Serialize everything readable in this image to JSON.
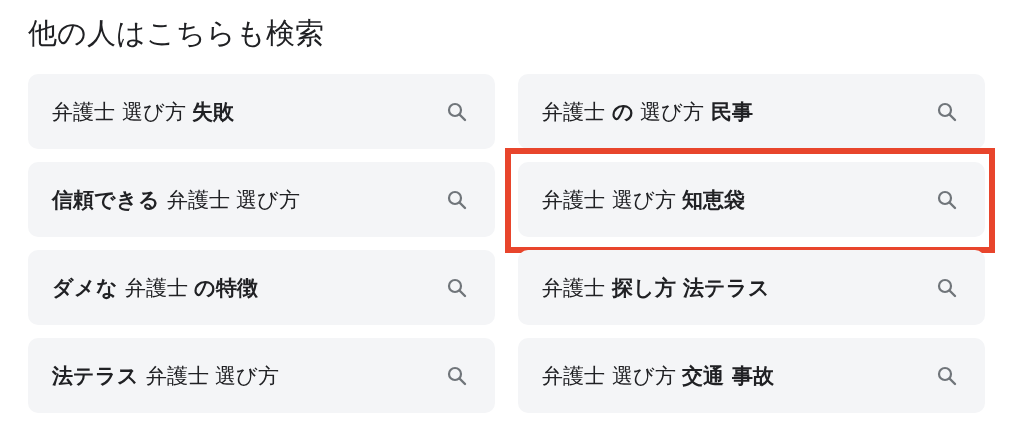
{
  "title": "他の人はこちらも検索",
  "suggestions": [
    {
      "text": "弁護士 選び方 **失敗**",
      "highlighted": false
    },
    {
      "text": "弁護士 **の** 選び方 **民事**",
      "highlighted": false
    },
    {
      "text": "**信頼できる** 弁護士 選び方",
      "highlighted": false
    },
    {
      "text": "弁護士 選び方 **知恵袋**",
      "highlighted": true
    },
    {
      "text": "**ダメな** 弁護士 **の特徴**",
      "highlighted": false
    },
    {
      "text": "弁護士 **探し方 法テラス**",
      "highlighted": false
    },
    {
      "text": "**法テラス** 弁護士 選び方",
      "highlighted": false
    },
    {
      "text": "弁護士 選び方 **交通 事故**",
      "highlighted": false
    }
  ]
}
